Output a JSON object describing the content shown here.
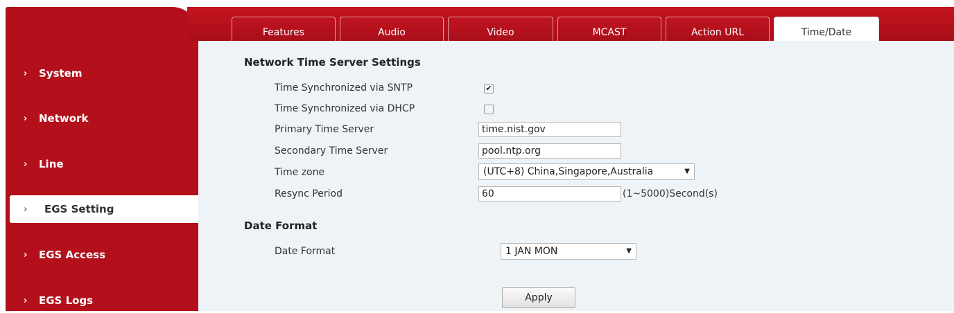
{
  "sidebar": {
    "items": [
      {
        "label": "System"
      },
      {
        "label": "Network"
      },
      {
        "label": "Line"
      },
      {
        "label": "EGS Setting"
      },
      {
        "label": "EGS Access"
      },
      {
        "label": "EGS Logs"
      }
    ],
    "active": "EGS Setting"
  },
  "tabs": [
    {
      "label": "Features"
    },
    {
      "label": "Audio"
    },
    {
      "label": "Video"
    },
    {
      "label": "MCAST"
    },
    {
      "label": "Action URL"
    },
    {
      "label": "Time/Date"
    }
  ],
  "active_tab": "Time/Date",
  "network_time": {
    "title": "Network Time Server Settings",
    "sntp_label": "Time Synchronized via SNTP",
    "sntp_checked": true,
    "dhcp_label": "Time Synchronized via DHCP",
    "dhcp_checked": false,
    "primary_label": "Primary Time Server",
    "primary_value": "time.nist.gov",
    "secondary_label": "Secondary Time Server",
    "secondary_value": "pool.ntp.org",
    "timezone_label": "Time zone",
    "timezone_value": "(UTC+8) China,Singapore,Australia",
    "resync_label": "Resync Period",
    "resync_value": "60",
    "resync_hint": "(1~5000)Second(s)"
  },
  "date_format": {
    "title": "Date Format",
    "label": "Date Format",
    "value": "1 JAN MON"
  },
  "apply_label": "Apply",
  "colors": {
    "brand_red": "#b4101c",
    "content_bg": "#eef3f8"
  },
  "icons": {
    "nav_chevron": "chevron-right-icon",
    "dropdown": "dropdown-arrow-icon"
  }
}
